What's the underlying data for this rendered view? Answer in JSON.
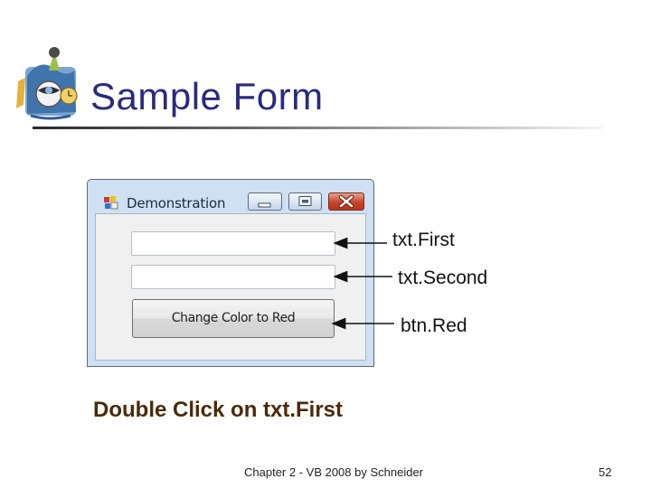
{
  "slide": {
    "title": "Sample Form",
    "caption": "Double Click on txt.First",
    "footer": "Chapter 2 - VB 2008 by Schneider",
    "page_number": "52"
  },
  "form": {
    "window_title": "Demonstration",
    "button_label": "Change Color to Red",
    "textbox_first_value": "",
    "textbox_second_value": ""
  },
  "annotations": {
    "first": "txt.First",
    "second": "txt.Second",
    "button": "btn.Red"
  }
}
